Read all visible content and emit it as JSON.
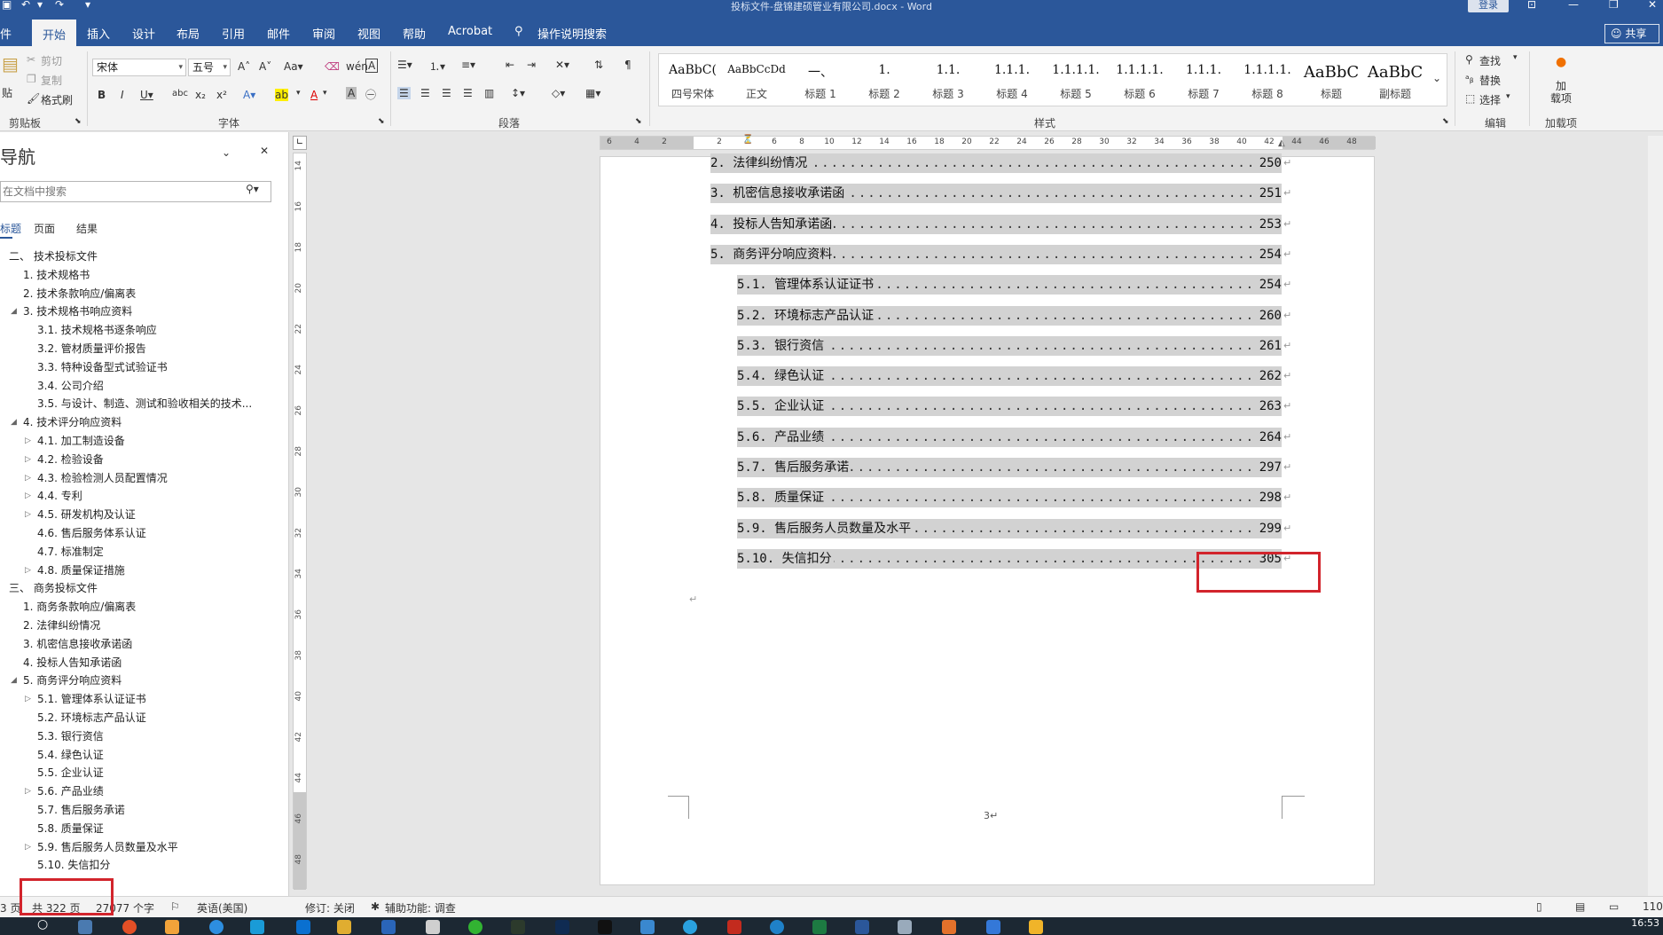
{
  "window": {
    "title": "投标文件-盘锦建硕管业有限公司.docx  -  Word",
    "login": "登录"
  },
  "tabs": [
    "件",
    "开始",
    "插入",
    "设计",
    "布局",
    "引用",
    "邮件",
    "审阅",
    "视图",
    "帮助",
    "Acrobat"
  ],
  "tell_me": "操作说明搜索",
  "share": "共享",
  "clipboard": {
    "paste": "贴",
    "cut": "剪切",
    "copy": "复制",
    "format_painter": "格式刷",
    "group": "剪贴板"
  },
  "font": {
    "name": "宋体",
    "size": "五号",
    "group": "字体"
  },
  "paragraph": {
    "group": "段落"
  },
  "styles": {
    "group": "样式",
    "items": [
      {
        "preview": "AaBbC(",
        "name": "四号宋体"
      },
      {
        "preview": "AaBbCcDd",
        "name": "正文"
      },
      {
        "preview": "一、",
        "name": "标题 1"
      },
      {
        "preview": "1.",
        "name": "标题 2"
      },
      {
        "preview": "1.1.",
        "name": "标题 3"
      },
      {
        "preview": "1.1.1.",
        "name": "标题 4"
      },
      {
        "preview": "1.1.1.1.",
        "name": "标题 5"
      },
      {
        "preview": "1.1.1.1.",
        "name": "标题 6"
      },
      {
        "preview": "1.1.1.",
        "name": "标题 7"
      },
      {
        "preview": "1.1.1.1.",
        "name": "标题 8"
      },
      {
        "preview": "AaBbC",
        "name": "标题"
      },
      {
        "preview": "AaBbC",
        "name": "副标题"
      }
    ]
  },
  "editing": {
    "find": "查找",
    "replace": "替换",
    "select": "选择",
    "group": "编辑"
  },
  "addins": {
    "load": "加\n载项",
    "group": "加载项"
  },
  "nav": {
    "title": "导航",
    "search_placeholder": "在文档中搜索",
    "tabs": [
      "标题",
      "页面",
      "结果"
    ],
    "items": [
      {
        "text": "二、 技术投标文件",
        "level": 0,
        "tri": ""
      },
      {
        "text": "1. 技术规格书",
        "level": 1,
        "tri": ""
      },
      {
        "text": "2. 技术条款响应/偏离表",
        "level": 1,
        "tri": ""
      },
      {
        "text": "3. 技术规格书响应资料",
        "level": 1,
        "tri": "◢"
      },
      {
        "text": "3.1. 技术规格书逐条响应",
        "level": 2,
        "tri": ""
      },
      {
        "text": "3.2. 管材质量评价报告",
        "level": 2,
        "tri": ""
      },
      {
        "text": "3.3. 特种设备型式试验证书",
        "level": 2,
        "tri": ""
      },
      {
        "text": "3.4. 公司介绍",
        "level": 2,
        "tri": ""
      },
      {
        "text": "3.5. 与设计、制造、测试和验收相关的技术...",
        "level": 2,
        "tri": ""
      },
      {
        "text": "4. 技术评分响应资料",
        "level": 1,
        "tri": "◢"
      },
      {
        "text": "4.1. 加工制造设备",
        "level": 2,
        "tri": "▷"
      },
      {
        "text": "4.2. 检验设备",
        "level": 2,
        "tri": "▷"
      },
      {
        "text": "4.3. 检验检测人员配置情况",
        "level": 2,
        "tri": "▷"
      },
      {
        "text": "4.4. 专利",
        "level": 2,
        "tri": "▷"
      },
      {
        "text": "4.5. 研发机构及认证",
        "level": 2,
        "tri": "▷"
      },
      {
        "text": "4.6. 售后服务体系认证",
        "level": 2,
        "tri": ""
      },
      {
        "text": "4.7. 标准制定",
        "level": 2,
        "tri": ""
      },
      {
        "text": "4.8. 质量保证措施",
        "level": 2,
        "tri": "▷"
      },
      {
        "text": "三、 商务投标文件",
        "level": 0,
        "tri": ""
      },
      {
        "text": "1. 商务条款响应/偏离表",
        "level": 1,
        "tri": ""
      },
      {
        "text": "2. 法律纠纷情况",
        "level": 1,
        "tri": ""
      },
      {
        "text": "3. 机密信息接收承诺函",
        "level": 1,
        "tri": ""
      },
      {
        "text": "4. 投标人告知承诺函",
        "level": 1,
        "tri": ""
      },
      {
        "text": "5. 商务评分响应资料",
        "level": 1,
        "tri": "◢"
      },
      {
        "text": "5.1. 管理体系认证证书",
        "level": 2,
        "tri": "▷"
      },
      {
        "text": "5.2. 环境标志产品认证",
        "level": 2,
        "tri": ""
      },
      {
        "text": "5.3. 银行资信",
        "level": 2,
        "tri": ""
      },
      {
        "text": "5.4. 绿色认证",
        "level": 2,
        "tri": ""
      },
      {
        "text": "5.5. 企业认证",
        "level": 2,
        "tri": ""
      },
      {
        "text": "5.6. 产品业绩",
        "level": 2,
        "tri": "▷"
      },
      {
        "text": "5.7. 售后服务承诺",
        "level": 2,
        "tri": ""
      },
      {
        "text": "5.8. 质量保证",
        "level": 2,
        "tri": ""
      },
      {
        "text": "5.9. 售后服务人员数量及水平",
        "level": 2,
        "tri": "▷"
      },
      {
        "text": "5.10. 失信扣分",
        "level": 2,
        "tri": ""
      }
    ]
  },
  "ruler": {
    "h_ticks": [
      "6",
      "4",
      "2",
      "2",
      "4",
      "6",
      "8",
      "10",
      "12",
      "14",
      "16",
      "18",
      "20",
      "22",
      "24",
      "26",
      "28",
      "30",
      "32",
      "34",
      "36",
      "38",
      "40",
      "42",
      "44",
      "46",
      "48"
    ],
    "v_ticks": [
      "14",
      "16",
      "18",
      "20",
      "22",
      "24",
      "26",
      "28",
      "30",
      "32",
      "34",
      "36",
      "38",
      "40",
      "42",
      "44",
      "46",
      "48"
    ]
  },
  "document": {
    "toc": [
      {
        "label": "2. 法律纠纷情况",
        "page": "250",
        "indent": 0
      },
      {
        "label": "3. 机密信息接收承诺函",
        "page": "251",
        "indent": 0
      },
      {
        "label": "4. 投标人告知承诺函",
        "page": "253",
        "indent": 0
      },
      {
        "label": "5. 商务评分响应资料",
        "page": "254",
        "indent": 0
      },
      {
        "label": "5.1. 管理体系认证证书",
        "page": "254",
        "indent": 1
      },
      {
        "label": "5.2. 环境标志产品认证",
        "page": "260",
        "indent": 1
      },
      {
        "label": "5.3. 银行资信",
        "page": "261",
        "indent": 1
      },
      {
        "label": "5.4. 绿色认证",
        "page": "262",
        "indent": 1
      },
      {
        "label": "5.5. 企业认证",
        "page": "263",
        "indent": 1
      },
      {
        "label": "5.6. 产品业绩",
        "page": "264",
        "indent": 1
      },
      {
        "label": "5.7. 售后服务承诺",
        "page": "297",
        "indent": 1
      },
      {
        "label": "5.8. 质量保证",
        "page": "298",
        "indent": 1
      },
      {
        "label": "5.9. 售后服务人员数量及水平",
        "page": "299",
        "indent": 1
      },
      {
        "label": "5.10. 失信扣分",
        "page": "305",
        "indent": 1
      }
    ],
    "page_number": "3↵"
  },
  "status": {
    "page": "3 页",
    "total_pages": "共 322 页",
    "words": "27077 个字",
    "language": "英语(美国)",
    "track_changes": "修订: 关闭",
    "accessibility": "辅助功能: 调查",
    "zoom": "110"
  },
  "clock": "16:53"
}
